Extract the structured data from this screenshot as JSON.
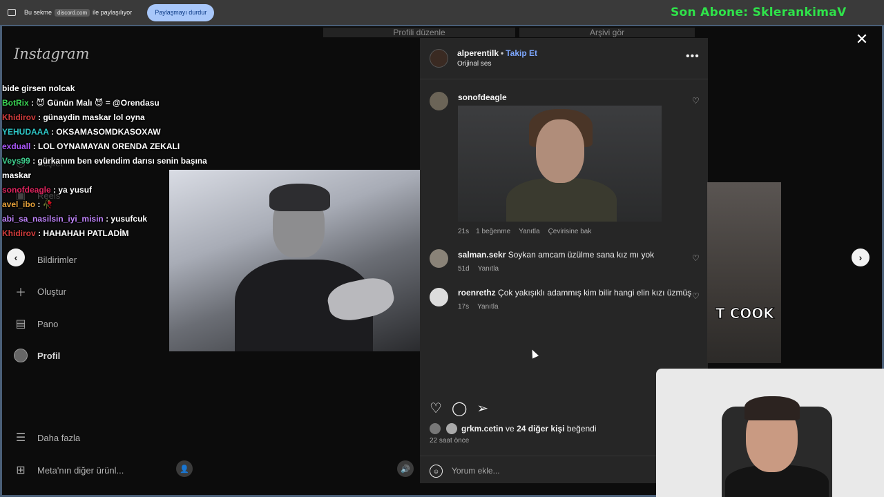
{
  "share_bar": {
    "prefix": "Bu sekme",
    "domain": "discord.com",
    "suffix": "ile paylaşılıyor",
    "stop_button": "Paylaşmayı durdur",
    "overlay_text": "Son Abone: SklerankimaV"
  },
  "instagram": {
    "logo": "Instagram",
    "profile_buttons": [
      "Profili düzenle",
      "Arşivi gör"
    ],
    "sidebar": [
      {
        "label": "Bildirimler",
        "icon": "heart-icon"
      },
      {
        "label": "Oluştur",
        "icon": "plus-icon"
      },
      {
        "label": "Pano",
        "icon": "chart-icon"
      },
      {
        "label": "Profil",
        "icon": "avatar"
      },
      {
        "label": "Daha fazla",
        "icon": "menu-icon"
      },
      {
        "label": "Meta'nın diğer ürünl...",
        "icon": "grid-icon"
      }
    ],
    "sidebar_faint": [
      "Keşfet",
      "Reels"
    ]
  },
  "chat": [
    {
      "user": "",
      "text": "bide girsen nolcak"
    },
    {
      "user": "BotRix",
      "text": ": 😈 Günün Malı 😈 = @Orendasu",
      "color": "#39d353"
    },
    {
      "user": "Khidirov",
      "text": ": günaydin maskar lol oyna",
      "color": "#d23c3c"
    },
    {
      "user": "YEHUDAAA",
      "text": ": OKSAMASOMDKASOXAW",
      "color": "#2ec7c7"
    },
    {
      "user": "exduall",
      "text": ": LOL OYNAMAYAN ORENDA ZEKALI",
      "color": "#a855f7"
    },
    {
      "user": "Veys99",
      "text": ": gürkanım ben evlendim darısı senin başına maskar",
      "color": "#3fcf8e"
    },
    {
      "user": "sonofdeagle",
      "text": ": ya yusuf",
      "color": "#e0245e"
    },
    {
      "user": "avel_ibo",
      "text": ": 🥀",
      "color": "#e8a23a"
    },
    {
      "user": "abi_sa_nasilsin_iyi_misin",
      "text": ": yusufcuk",
      "color": "#c084fc"
    },
    {
      "user": "Khidirov",
      "text": ": HAHAHAH PATLADİM",
      "color": "#d23c3c"
    }
  ],
  "post": {
    "author": "alperentilk",
    "follow": "Takip Et",
    "audio": "Orijinal ses",
    "more": "•••",
    "comments": [
      {
        "user": "sonofdeagle",
        "text": "",
        "age": "21s",
        "likes": "1 beğenme",
        "reply": "Yanıtla",
        "translate": "Çevirisine bak"
      },
      {
        "user": "salman.sekr",
        "text": "Soykan amcam üzülme sana kız mı yok",
        "age": "51d",
        "reply": "Yanıtla"
      },
      {
        "user": "roenrethz",
        "text": "Çok yakışıklı adammış kim bilir hangi elin kızı üzmüş",
        "age": "17s",
        "reply": "Yanıtla"
      }
    ],
    "liked_by_user": "grkm.cetin",
    "liked_by_mid": "ve",
    "liked_by_others": "24 diğer kişi",
    "liked_by_suffix": "beğendi",
    "time_ago": "22 saat önce",
    "comment_placeholder": "Yorum ekle..."
  },
  "next_card_text": "T COOK"
}
